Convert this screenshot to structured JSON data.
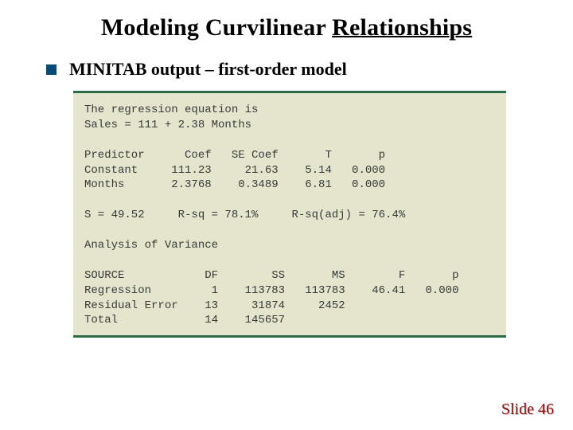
{
  "title_prefix": "Modeling Curvilinear ",
  "title_underlined": "Relationships",
  "subtitle": "MINITAB output – first-order model",
  "chart_data": {
    "type": "table",
    "regression_equation": {
      "response": "Sales",
      "intercept": 111,
      "slope": 2.38,
      "predictor": "Months"
    },
    "coefficients": {
      "columns": [
        "Predictor",
        "Coef",
        "SE Coef",
        "T",
        "p"
      ],
      "rows": [
        {
          "Predictor": "Constant",
          "Coef": 111.23,
          "SE Coef": 21.63,
          "T": 5.14,
          "p": 0.0
        },
        {
          "Predictor": "Months",
          "Coef": 2.3768,
          "SE Coef": 0.3489,
          "T": 6.81,
          "p": 0.0
        }
      ]
    },
    "summary": {
      "S": 49.52,
      "R_sq_pct": 78.1,
      "R_sq_adj_pct": 76.4
    },
    "anova": {
      "columns": [
        "SOURCE",
        "DF",
        "SS",
        "MS",
        "F",
        "p"
      ],
      "rows": [
        {
          "SOURCE": "Regression",
          "DF": 1,
          "SS": 113783,
          "MS": 113783,
          "F": 46.41,
          "p": 0.0
        },
        {
          "SOURCE": "Residual Error",
          "DF": 13,
          "SS": 31874,
          "MS": 2452
        },
        {
          "SOURCE": "Total",
          "DF": 14,
          "SS": 145657
        }
      ]
    }
  },
  "output_lines": {
    "l0": "The regression equation is",
    "l1": "Sales = 111 + 2.38 Months",
    "l2": "",
    "l3": "Predictor      Coef   SE Coef       T       p",
    "l4": "Constant     111.23     21.63    5.14   0.000",
    "l5": "Months       2.3768    0.3489    6.81   0.000",
    "l6": "",
    "l7": "S = 49.52     R-sq = 78.1%     R-sq(adj) = 76.4%",
    "l8": "",
    "l9": "Analysis of Variance",
    "l10": "",
    "l11": "SOURCE            DF        SS       MS        F       p",
    "l12": "Regression         1    113783   113783    46.41   0.000",
    "l13": "Residual Error    13     31874     2452",
    "l14": "Total             14    145657"
  },
  "footer": {
    "label": "Slide",
    "number": "46"
  }
}
